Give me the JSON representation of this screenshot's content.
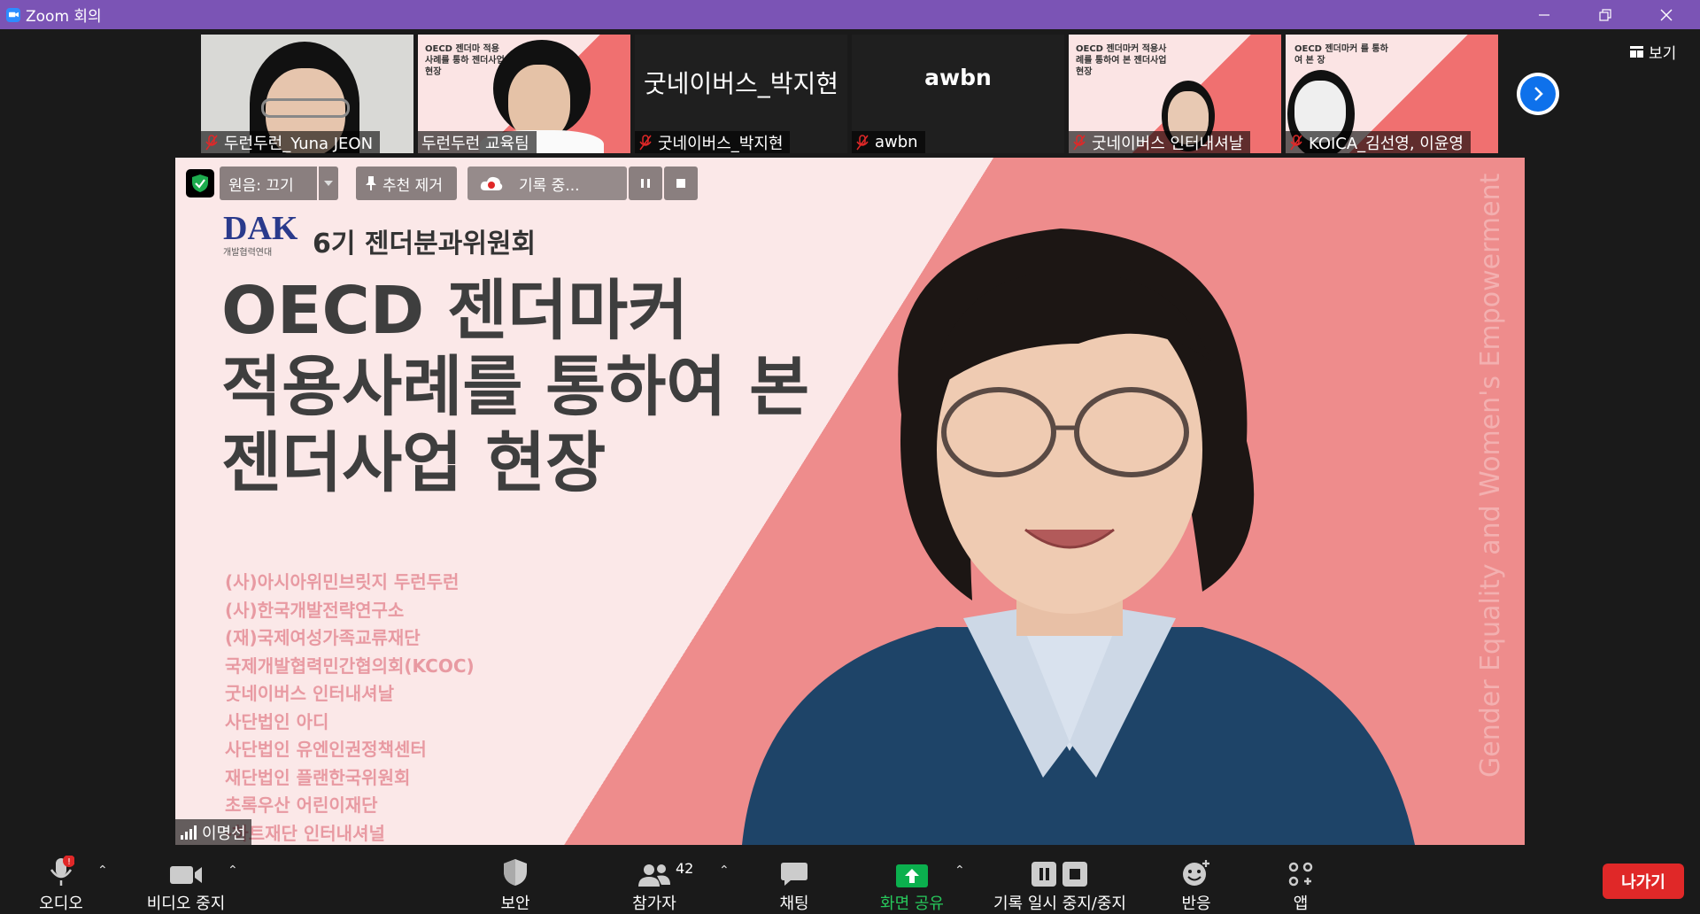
{
  "window": {
    "title": "Zoom 회의"
  },
  "colors": {
    "titlebar": "#7b54b5",
    "accent": "#0e71eb",
    "leave": "#e02828",
    "share": "#0bb04e"
  },
  "view_button": {
    "label": "보기"
  },
  "thumbnails": [
    {
      "name": "두런두런_Yuna JEON",
      "type": "video"
    },
    {
      "name": "두런두런 교육팀",
      "type": "slide",
      "slide_text": "OECD 젠더마 적용사례를 통하 젠더사업 현장"
    },
    {
      "name": "굿네이버스_박지현",
      "type": "name-only",
      "display": "굿네이버스_박지현"
    },
    {
      "name": "awbn",
      "type": "name-only",
      "display": "awbn"
    },
    {
      "name": "굿네이버스 인터내셔날",
      "type": "slide",
      "slide_text": "OECD 젠더마커 적용사례를 통하여 본 젠더사업 현장"
    },
    {
      "name": "KOICA_김선영, 이윤영",
      "type": "slide",
      "slide_text": "OECD 젠더마커 를 통하여 본 장"
    }
  ],
  "main_video": {
    "controls": {
      "original_sound": "원음: 끄기",
      "remove_spotlight": "추천 제거",
      "recording": "기록 중..."
    },
    "speaker_name": "이명선",
    "slide": {
      "logo": "DAK",
      "logo_sub": "개발협력연대",
      "subtitle": "6기 젠더분과위원회",
      "title_lines": [
        "OECD 젠더마커",
        "적용사례를 통하여 본",
        "젠더사업 현장"
      ],
      "orgs": [
        "(사)아시아위민브릿지 두런두런",
        "(사)한국개발전략연구소",
        "(재)국제여성가족교류재단",
        "국제개발협력민간협의회(KCOC)",
        "굿네이버스 인터내셔날",
        "사단법인 아디",
        "사단법인 유엔인권정책센터",
        "재단법인 플랜한국위원회",
        "초록우산 어린이재단",
        "-하트재단 인터내셔널"
      ],
      "vertical_text": "Gender Equality and Women's Empowerment"
    }
  },
  "toolbar": {
    "audio": "오디오",
    "video": "비디오 중지",
    "security": "보안",
    "participants": "참가자",
    "participants_count": "42",
    "chat": "채팅",
    "share": "화면 공유",
    "record": "기록 일시 중지/중지",
    "reactions": "반응",
    "apps": "앱",
    "leave": "나가기"
  }
}
